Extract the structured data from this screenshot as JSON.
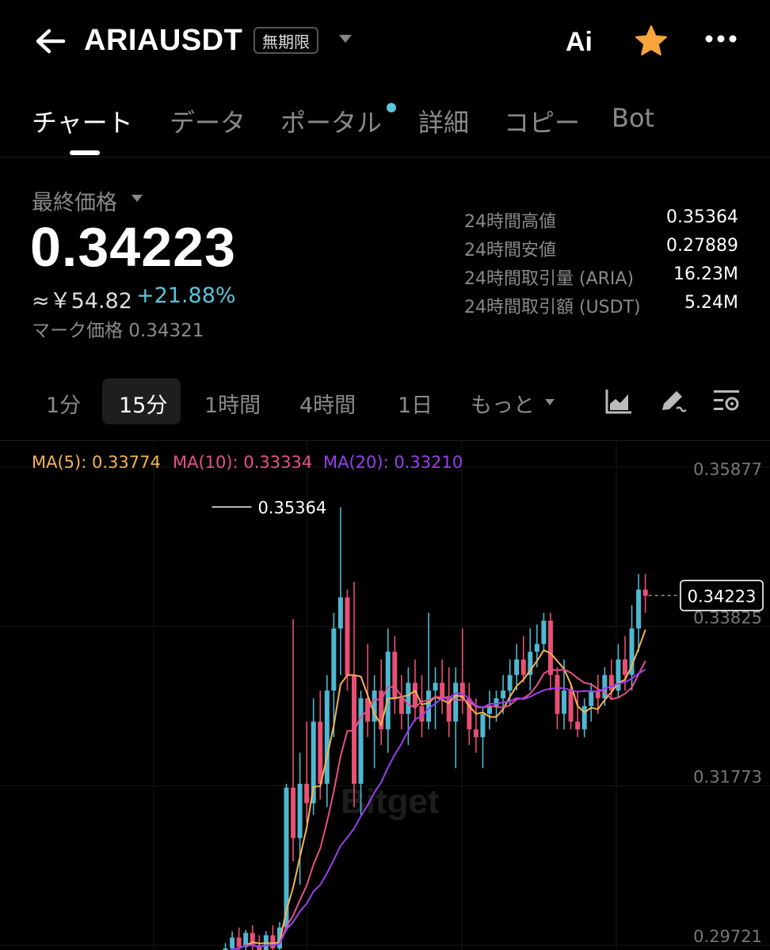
{
  "header": {
    "title": "ARIAUSDT",
    "badge": "無期限",
    "ai_label": "Ai",
    "icons": [
      "back-arrow-icon",
      "dropdown-caret-icon",
      "star-icon",
      "more-icon"
    ],
    "star_color": "#f7a53c"
  },
  "tabs": [
    {
      "label": "チャート",
      "active": true
    },
    {
      "label": "データ"
    },
    {
      "label": "ポータル",
      "has_dot": true
    },
    {
      "label": "詳細"
    },
    {
      "label": "コピー"
    },
    {
      "label": "Bot"
    }
  ],
  "price": {
    "label": "最終価格",
    "last": "0.34223",
    "fiat": "≈￥54.82",
    "change": "+21.88%",
    "mark": "マーク価格 0.34321"
  },
  "stats": [
    {
      "label": "24時間高値",
      "value": "0.35364"
    },
    {
      "label": "24時間安値",
      "value": "0.27889"
    },
    {
      "label": "24時間取引量 (ARIA)",
      "value": "16.23M"
    },
    {
      "label": "24時間取引額 (USDT)",
      "value": "5.24M"
    }
  ],
  "timeframes": {
    "items": [
      "1分",
      "15分",
      "1時間",
      "4時間",
      "1日"
    ],
    "selected": "15分",
    "more": "もっと"
  },
  "toolbar_icons": [
    "chart-type-icon",
    "draw-tool-icon",
    "indicator-settings-icon"
  ],
  "chart": {
    "ma": [
      {
        "label": "MA(5): 0.33774",
        "color": "#f5b451"
      },
      {
        "label": "MA(10): 0.33334",
        "color": "#e84f8a"
      },
      {
        "label": "MA(20): 0.33210",
        "color": "#9a3ff0"
      }
    ],
    "axis_labels": [
      "0.35877",
      "0.33825",
      "0.31773",
      "0.29721"
    ],
    "high_marker": "0.35364",
    "current_price_tag": "0.34223",
    "watermark": "Bitget",
    "up_color": "#4fb7d1",
    "down_color": "#e84f73"
  },
  "chart_data": {
    "type": "candlestick",
    "y_range": [
      0.29721,
      0.35877
    ],
    "y_ticks": [
      0.35877,
      0.33825,
      0.31773,
      0.29721
    ],
    "high": 0.35364,
    "last": 0.34223,
    "candles": [
      [
        0.295,
        0.2962,
        0.2938,
        0.2952
      ],
      [
        0.2952,
        0.2975,
        0.2945,
        0.2968
      ],
      [
        0.2968,
        0.299,
        0.296,
        0.2982
      ],
      [
        0.2982,
        0.2995,
        0.2962,
        0.297
      ],
      [
        0.297,
        0.2992,
        0.2958,
        0.2988
      ],
      [
        0.2988,
        0.2998,
        0.2962,
        0.2972
      ],
      [
        0.2972,
        0.2985,
        0.295,
        0.296
      ],
      [
        0.296,
        0.299,
        0.2955,
        0.2985
      ],
      [
        0.2985,
        0.2998,
        0.296,
        0.2968
      ],
      [
        0.2968,
        0.3002,
        0.2962,
        0.2995
      ],
      [
        0.2995,
        0.318,
        0.299,
        0.3175
      ],
      [
        0.3175,
        0.3392,
        0.308,
        0.311
      ],
      [
        0.311,
        0.322,
        0.305,
        0.318
      ],
      [
        0.318,
        0.326,
        0.313,
        0.3155
      ],
      [
        0.3155,
        0.329,
        0.314,
        0.326
      ],
      [
        0.326,
        0.33,
        0.316,
        0.318
      ],
      [
        0.318,
        0.332,
        0.315,
        0.33
      ],
      [
        0.33,
        0.34,
        0.324,
        0.338
      ],
      [
        0.338,
        0.3536,
        0.332,
        0.342
      ],
      [
        0.342,
        0.343,
        0.33,
        0.332
      ],
      [
        0.332,
        0.344,
        0.315,
        0.318
      ],
      [
        0.318,
        0.33,
        0.314,
        0.329
      ],
      [
        0.329,
        0.336,
        0.324,
        0.326
      ],
      [
        0.326,
        0.332,
        0.32,
        0.33
      ],
      [
        0.33,
        0.334,
        0.323,
        0.325
      ],
      [
        0.325,
        0.338,
        0.322,
        0.335
      ],
      [
        0.335,
        0.337,
        0.327,
        0.329
      ],
      [
        0.329,
        0.332,
        0.325,
        0.327
      ],
      [
        0.327,
        0.333,
        0.323,
        0.331
      ],
      [
        0.331,
        0.334,
        0.326,
        0.328
      ],
      [
        0.328,
        0.332,
        0.324,
        0.326
      ],
      [
        0.326,
        0.34,
        0.325,
        0.33
      ],
      [
        0.33,
        0.333,
        0.325,
        0.331
      ],
      [
        0.331,
        0.334,
        0.327,
        0.329
      ],
      [
        0.329,
        0.333,
        0.324,
        0.326
      ],
      [
        0.326,
        0.333,
        0.32,
        0.331
      ],
      [
        0.331,
        0.338,
        0.327,
        0.329
      ],
      [
        0.329,
        0.331,
        0.323,
        0.325
      ],
      [
        0.325,
        0.329,
        0.322,
        0.324
      ],
      [
        0.324,
        0.328,
        0.32,
        0.327
      ],
      [
        0.327,
        0.33,
        0.325,
        0.328
      ],
      [
        0.328,
        0.33,
        0.326,
        0.329
      ],
      [
        0.329,
        0.332,
        0.327,
        0.33
      ],
      [
        0.33,
        0.334,
        0.328,
        0.332
      ],
      [
        0.332,
        0.336,
        0.33,
        0.334
      ],
      [
        0.334,
        0.337,
        0.331,
        0.332
      ],
      [
        0.332,
        0.338,
        0.33,
        0.335
      ],
      [
        0.335,
        0.3385,
        0.333,
        0.336
      ],
      [
        0.336,
        0.34,
        0.335,
        0.339
      ],
      [
        0.339,
        0.34,
        0.33,
        0.332
      ],
      [
        0.332,
        0.333,
        0.325,
        0.327
      ],
      [
        0.327,
        0.334,
        0.325,
        0.33
      ],
      [
        0.33,
        0.331,
        0.325,
        0.326
      ],
      [
        0.326,
        0.33,
        0.324,
        0.325
      ],
      [
        0.325,
        0.329,
        0.324,
        0.328
      ],
      [
        0.328,
        0.331,
        0.326,
        0.33
      ],
      [
        0.33,
        0.332,
        0.327,
        0.329
      ],
      [
        0.329,
        0.333,
        0.328,
        0.332
      ],
      [
        0.332,
        0.334,
        0.329,
        0.33
      ],
      [
        0.33,
        0.336,
        0.329,
        0.334
      ],
      [
        0.334,
        0.337,
        0.33,
        0.332
      ],
      [
        0.332,
        0.341,
        0.33,
        0.338
      ],
      [
        0.338,
        0.345,
        0.335,
        0.343
      ],
      [
        0.343,
        0.345,
        0.34,
        0.3422
      ]
    ]
  }
}
